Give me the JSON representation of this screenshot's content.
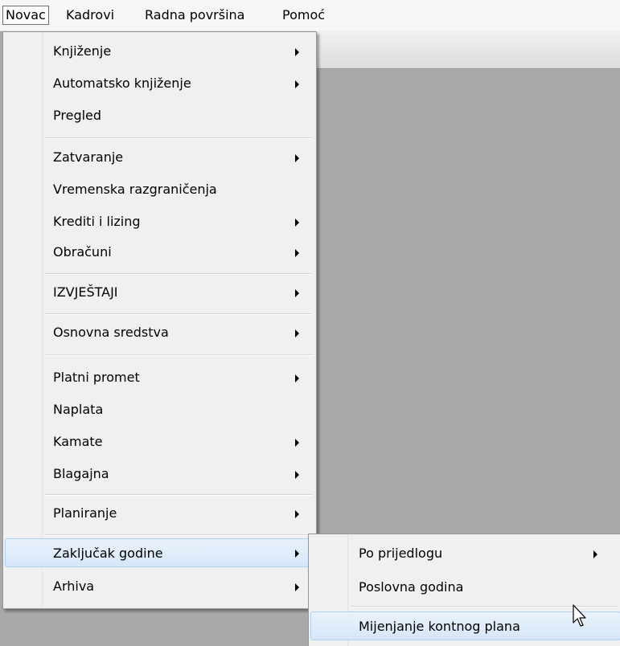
{
  "menubar": {
    "items": [
      {
        "label": "Novac"
      },
      {
        "label": "Kadrovi"
      },
      {
        "label": "Radna površina"
      },
      {
        "label": "Pomoć"
      }
    ]
  },
  "main_menu": {
    "items": [
      {
        "label": "Knjiženje",
        "submenu": true
      },
      {
        "label": "Automatsko knjiženje",
        "submenu": true
      },
      {
        "label": "Pregled",
        "submenu": false
      },
      {
        "label": "Zatvaranje",
        "submenu": true
      },
      {
        "label": "Vremenska razgraničenja",
        "submenu": false
      },
      {
        "label": "Krediti i lizing",
        "submenu": true
      },
      {
        "label": "Obračuni",
        "submenu": true
      },
      {
        "label": "IZVJEŠTAJI",
        "submenu": true
      },
      {
        "label": "Osnovna sredstva",
        "submenu": true
      },
      {
        "label": "Platni promet",
        "submenu": true
      },
      {
        "label": "Naplata",
        "submenu": false
      },
      {
        "label": "Kamate",
        "submenu": true
      },
      {
        "label": "Blagajna",
        "submenu": true
      },
      {
        "label": "Planiranje",
        "submenu": true
      },
      {
        "label": "Zaključak godine",
        "submenu": true,
        "highlighted": true
      },
      {
        "label": "Arhiva",
        "submenu": true
      }
    ]
  },
  "sub_menu": {
    "items": [
      {
        "label": "Po prijedlogu",
        "submenu": true
      },
      {
        "label": "Poslovna godina",
        "submenu": false
      },
      {
        "label": "Mijenjanje kontnog plana",
        "submenu": false,
        "highlighted": true
      }
    ]
  },
  "icons": {
    "submenu_arrow": "triangle-right-icon",
    "cursor": "mouse-pointer-icon"
  },
  "colors": {
    "menu_bg": "#f0f0f0",
    "highlight_bg": "#dce9f7",
    "highlight_border": "#aecff7",
    "workspace_bg": "#a9a9a9"
  }
}
